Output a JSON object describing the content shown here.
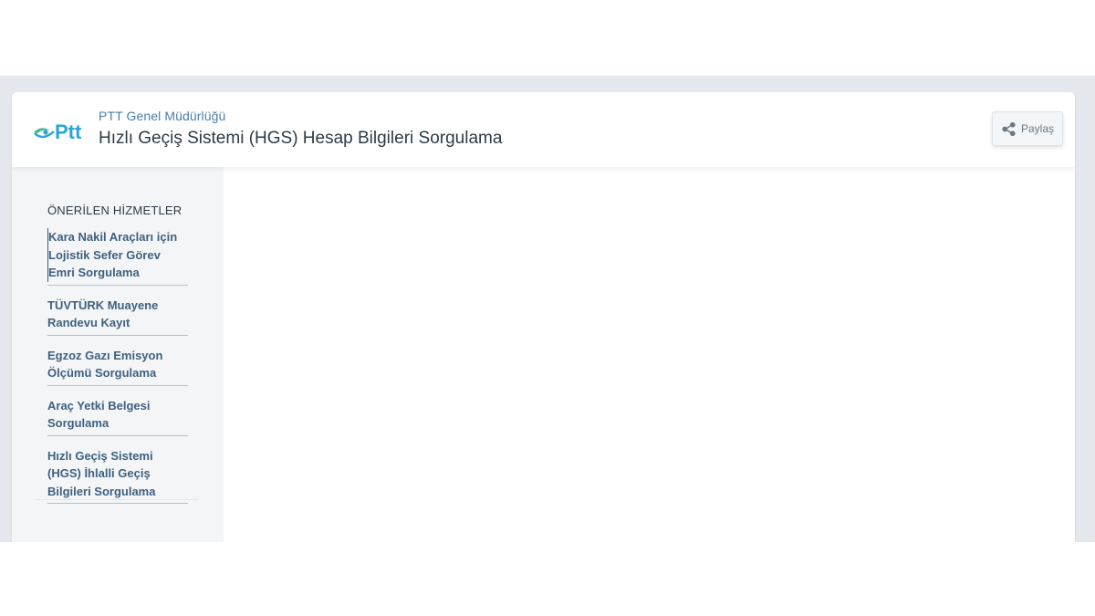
{
  "header": {
    "logo_text": "Ptt",
    "org_name": "PTT Genel Müdürlüğü",
    "service_title": "Hızlı Geçiş Sistemi (HGS) Hesap Bilgileri Sorgulama",
    "share_label": "Paylaş",
    "share_icon": "share-icon"
  },
  "sidebar": {
    "title": "ÖNERİLEN HİZMETLER",
    "items": [
      {
        "label": "Kara Nakil Araçları için Lojistik Sefer Görev Emri Sorgulama"
      },
      {
        "label": "TÜVTÜRK Muayene Randevu Kayıt"
      },
      {
        "label": "Egzoz Gazı Emisyon Ölçümü Sorgulama"
      },
      {
        "label": "Araç Yetki Belgesi Sorgulama"
      },
      {
        "label": "Hızlı Geçiş Sistemi (HGS) İhlalli Geçiş Bilgileri Sorgulama"
      }
    ]
  },
  "colors": {
    "page_band": "#e4e8ec",
    "sidebar_bg": "#f3f5f7",
    "link": "#3f607f",
    "org_name": "#4a7fa8",
    "logo_blue": "#2aa6d6",
    "logo_green": "#3fb68b"
  }
}
